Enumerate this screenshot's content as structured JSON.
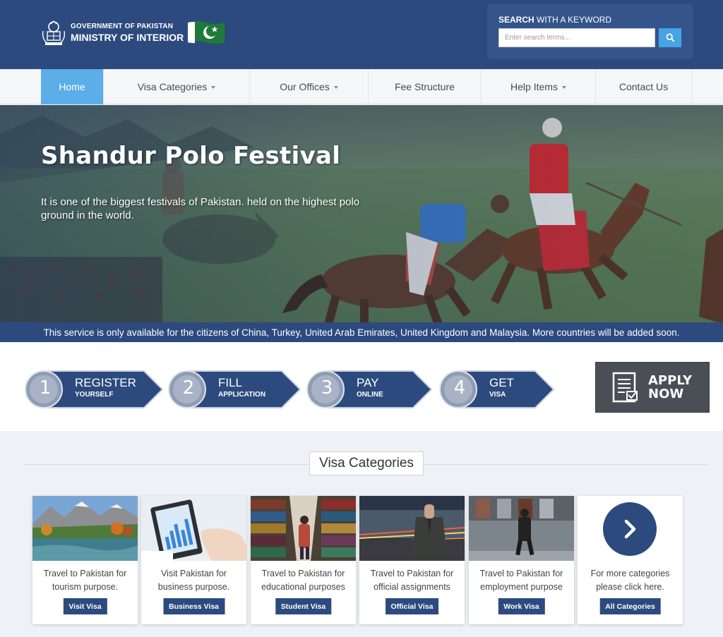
{
  "header": {
    "logo_line1": "GOVERNMENT OF PAKISTAN",
    "logo_line2": "MINISTRY OF INTERIOR",
    "search_label_bold": "SEARCH",
    "search_label_rest": " WITH A KEYWORD",
    "search_placeholder": "Enter search terms...",
    "search_icon": "search-icon"
  },
  "nav": {
    "items": [
      {
        "label": "Home",
        "active": true
      },
      {
        "label": "Visa Categories",
        "dropdown": true
      },
      {
        "label": "Our Offices",
        "dropdown": true
      },
      {
        "label": "Fee Structure"
      },
      {
        "label": "Help Items",
        "dropdown": true
      },
      {
        "label": "Contact Us"
      }
    ]
  },
  "hero": {
    "title": "Shandur Polo Festival",
    "description": "It is one of the biggest festivals of Pakistan. held on the highest polo ground in the world.",
    "notice": "This service is only available for the citizens of China, Turkey, United Arab Emirates, United Kingdom and Malaysia. More countries will be added soon."
  },
  "steps": [
    {
      "number": "1",
      "main": "REGISTER",
      "sub": "YOURSELF"
    },
    {
      "number": "2",
      "main": "FILL",
      "sub": "APPLICATION"
    },
    {
      "number": "3",
      "main": "PAY",
      "sub": "ONLINE"
    },
    {
      "number": "4",
      "main": "GET",
      "sub": "VISA"
    }
  ],
  "apply": {
    "line1": "APPLY",
    "line2": "NOW"
  },
  "visa_section": {
    "title": "Visa Categories",
    "cards": [
      {
        "text": "Travel to Pakistan for tourism purpose.",
        "button": "Visit Visa"
      },
      {
        "text": "Visit Pakistan for business purpose.",
        "button": "Business Visa"
      },
      {
        "text": "Travel to Pakistan for educational purposes",
        "button": "Student Visa"
      },
      {
        "text": "Travel to Pakistan for official assignments",
        "button": "Official Visa"
      },
      {
        "text": "Travel to Pakistan for employment purpose",
        "button": "Work Visa"
      },
      {
        "text": "For more categories please click here.",
        "button": "All Categories"
      }
    ]
  },
  "colors": {
    "primary": "#2c4a7e",
    "accent": "#5baee8",
    "search_button": "#45a3e6"
  }
}
